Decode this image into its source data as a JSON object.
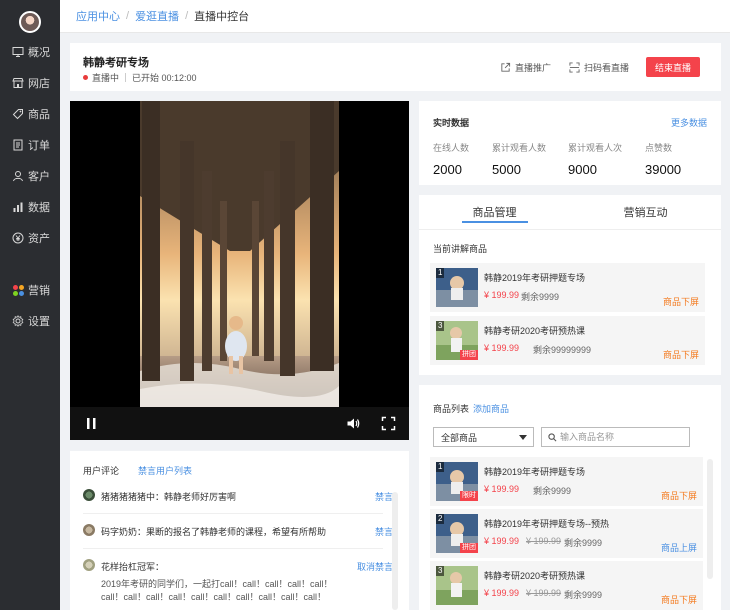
{
  "sidebar": {
    "items": [
      {
        "label": "概况",
        "icon": "monitor-icon"
      },
      {
        "label": "网店",
        "icon": "store-icon"
      },
      {
        "label": "商品",
        "icon": "tag-icon"
      },
      {
        "label": "订单",
        "icon": "document-icon"
      },
      {
        "label": "客户",
        "icon": "user-icon"
      },
      {
        "label": "数据",
        "icon": "bar-chart-icon"
      },
      {
        "label": "资产",
        "icon": "yen-coin-icon"
      },
      {
        "label": "营销",
        "icon": "apps-icon"
      },
      {
        "label": "设置",
        "icon": "gear-icon"
      }
    ]
  },
  "breadcrumb": {
    "items": [
      "应用中心",
      "爱逛直播",
      "直播中控台"
    ],
    "separator": "/"
  },
  "live": {
    "title": "韩静考研专场",
    "status": "直播中",
    "elapsed": "已开始 00:12:00",
    "promote_label": "直播推广",
    "scan_label": "扫码看直播",
    "end_label": "结束直播"
  },
  "realtime": {
    "title": "实时数据",
    "more": "更多数据",
    "stats": [
      {
        "label": "在线人数",
        "value": "2000"
      },
      {
        "label": "累计观看人数",
        "value": "5000"
      },
      {
        "label": "累计观看人次",
        "value": "9000"
      },
      {
        "label": "点赞数",
        "value": "39000"
      }
    ]
  },
  "tabs": [
    "商品管理",
    "营销互动"
  ],
  "current": {
    "label": "当前讲解商品",
    "items": [
      {
        "num": "1",
        "name": "韩静2019年考研押题专场",
        "price": "¥ 199.99",
        "stock": "剩余9999",
        "action": "商品下屏",
        "tag": ""
      },
      {
        "num": "3",
        "name": "韩静考研2020考研预热课",
        "price": "¥ 199.99",
        "stock": "剩余99999999",
        "action": "商品下屏",
        "tag": "拼团"
      }
    ]
  },
  "productList": {
    "title": "商品列表",
    "add": "添加商品",
    "filter": "全部商品",
    "search_placeholder": "输入商品名称",
    "items": [
      {
        "num": "1",
        "name": "韩静2019年考研押题专场",
        "price": "¥ 199.99",
        "orig": "",
        "stock": "剩余9999",
        "action": "商品下屏",
        "tag": "限时"
      },
      {
        "num": "2",
        "name": "韩静2019年考研押题专场--预热",
        "price": "¥ 199.99",
        "orig": "¥ 199.99",
        "stock": "剩余9999",
        "action": "商品上屏",
        "tag": "拼团"
      },
      {
        "num": "3",
        "name": "韩静考研2020考研预热课",
        "price": "¥ 199.99",
        "orig": "¥ 199.99",
        "stock": "剩余9999",
        "action": "商品下屏",
        "tag": ""
      }
    ]
  },
  "comments": {
    "title": "用户评论",
    "blocked_link": "禁言用户列表",
    "items": [
      {
        "text": "猪猪猪猪猪中：韩静老师好厉害啊",
        "action": "禁言",
        "body": ""
      },
      {
        "text": "码字奶奶：果断的报名了韩静老师的课程，希望有所帮助",
        "action": "禁言",
        "body": ""
      },
      {
        "text": "花样抬杠冠军：",
        "action": "取消禁言",
        "body": "2019年考研的同学们，一起打call！call！call！call！call！call！call！call！call！call！call！call！call！call！call！"
      }
    ]
  },
  "colors": {
    "accent": "#4a90e2",
    "danger": "#f4434b",
    "warning": "#f47b20",
    "sidebar": "#2b2d31"
  }
}
